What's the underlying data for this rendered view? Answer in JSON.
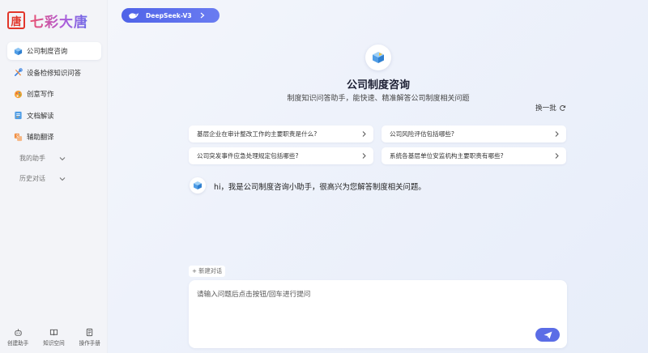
{
  "app": {
    "logo_mark": "唐",
    "logo_text": "七彩大唐"
  },
  "sidebar": {
    "items": [
      {
        "label": "公司制度咨询",
        "icon": "cube-icon",
        "active": true
      },
      {
        "label": "设备检修知识问答",
        "icon": "tools-icon",
        "active": false
      },
      {
        "label": "创意写作",
        "icon": "palette-icon",
        "active": false
      },
      {
        "label": "文档解读",
        "icon": "document-icon",
        "active": false
      },
      {
        "label": "辅助翻译",
        "icon": "translate-icon",
        "active": false
      }
    ],
    "groups": [
      {
        "label": "我的助手"
      },
      {
        "label": "历史对话"
      }
    ],
    "bottom_tools": [
      {
        "label": "创建助手",
        "icon": "robot-icon"
      },
      {
        "label": "知识空间",
        "icon": "book-icon"
      },
      {
        "label": "操作手册",
        "icon": "manual-icon"
      }
    ]
  },
  "model_selector": {
    "label": "DeepSeek-V3"
  },
  "hero": {
    "title": "公司制度咨询",
    "subtitle": "制度知识问答助手，能快速、精准解答公司制度相关问题",
    "refresh_label": "换一批"
  },
  "suggestions": [
    "基层企业在审计整改工作的主要职责是什么?",
    "公司风险评估包括哪些?",
    "公司突发事件应急处理规定包括哪些?",
    "系统各基层单位安监机构主要职责有哪些?"
  ],
  "chat": {
    "greeting": "hi，我是公司制度咨询小助手，很高兴为您解答制度相关问题。"
  },
  "composer": {
    "new_chat_label": "+ 新建对话",
    "placeholder": "请输入问题后点击按钮/回车进行提问",
    "value": ""
  },
  "colors": {
    "accent": "#5b6de6",
    "logo_red": "#e2362a"
  }
}
